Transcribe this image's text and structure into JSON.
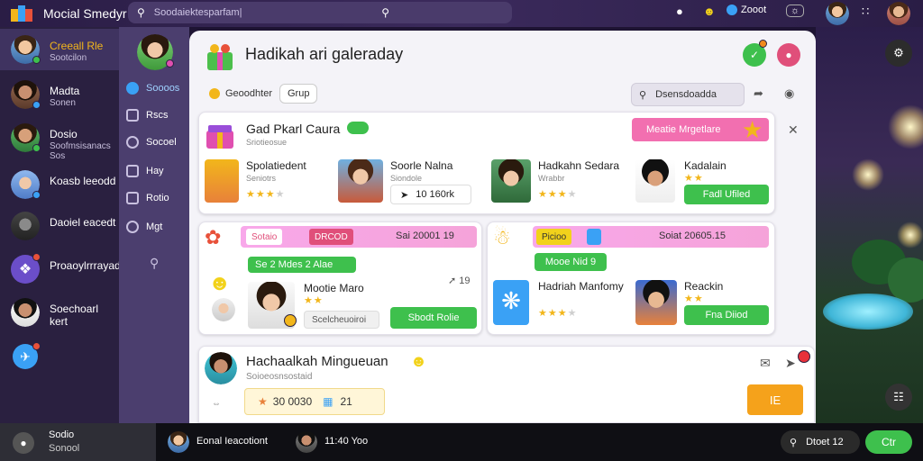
{
  "app": {
    "name": "Mocial Smedyr"
  },
  "search": {
    "placeholder": "Soodaiektesparfam|"
  },
  "topbar": {
    "status": "Zooot"
  },
  "sidebar": {
    "items": [
      {
        "name": "Creeall Rle",
        "sub": "Sootcilon"
      },
      {
        "name": "Madta",
        "sub": "Sonen"
      },
      {
        "name": "Dosio",
        "sub": "Soofmsisanacs"
      },
      {
        "name": "Koasb leeodd",
        "sub": ""
      },
      {
        "name": "Daoiel eacedt",
        "sub": ""
      },
      {
        "name": "Proaoylrrrayad",
        "sub": ""
      },
      {
        "name": "Soechoarl kert",
        "sub": ""
      }
    ]
  },
  "nav": {
    "items": [
      {
        "label": "Soooos"
      },
      {
        "label": "Rscs"
      },
      {
        "label": "Socoel"
      },
      {
        "label": "Hay"
      },
      {
        "label": "Rotio"
      },
      {
        "label": "Mgt"
      }
    ]
  },
  "main": {
    "title": "Hadikah ari galeraday",
    "chips": {
      "filter1": "Geoodhter",
      "filter2": "Grup",
      "search": "Dsensdoadda"
    }
  },
  "card1": {
    "title": "Gad Pkarl Caura",
    "sub": "Sriotieosue",
    "banner": "Meatie Mrgetlare",
    "items": [
      {
        "title": "Spolatiedent",
        "sub": "Seniotrs",
        "rating": 3
      },
      {
        "title": "Soorle Nalna",
        "sub": "Siondole",
        "meta": "10 160rk"
      },
      {
        "title": "Hadkahn Sedara",
        "sub": "Wrabbr",
        "rating": 3
      },
      {
        "title": "Kadalain",
        "sub": "",
        "rating": 2,
        "btn": "Fadl Ufiled"
      }
    ]
  },
  "card2": {
    "tag1": "Sotaio",
    "tag2": "DRCOD",
    "right": "Sai 20001 19",
    "green": "Se 2 Mdes 2 Alae",
    "person": "Mootie Maro",
    "field": "Scelcheuoiroi",
    "meta": "19",
    "btn": "Sbodt Rolie"
  },
  "card3": {
    "tag1": "Picioo",
    "right": "Soiat 20605.15",
    "green": "Mooe Nid 9",
    "items": [
      {
        "title": "Hadriah Manfomy",
        "rating": 3
      },
      {
        "title": "Reackin",
        "rating": 2,
        "btn": "Fna Diiod"
      }
    ]
  },
  "card4": {
    "title": "Hachaalkah Mingueuan",
    "sub": "Soioeosnsostaid",
    "stat1": "30 0030",
    "stat2": "21",
    "btn": "IE"
  },
  "bottombar": {
    "user_name": "Sodio",
    "user_sub": "Sonool",
    "contact1": "Eonal Ieacotiont",
    "contact2": "11:40 Yoo",
    "counter": "Dtoet 12",
    "action": "Ctr"
  }
}
